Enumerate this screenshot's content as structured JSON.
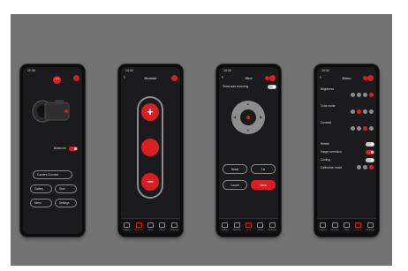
{
  "status": {
    "time": "10:34",
    "battery": "■■"
  },
  "phone1": {
    "badge_text": "LEICA",
    "toggle_label": "Bluetooth",
    "buttons": [
      "Camera Connect",
      "Gallery",
      "Shot",
      "Menu",
      "Settings"
    ]
  },
  "phone2": {
    "title": "Remote",
    "plus": "+",
    "minus": "−"
  },
  "phone3": {
    "title": "Shot",
    "toggle_label": "Show auto recording",
    "buttons": [
      "Reset",
      "Fix",
      "Cancel",
      "Save"
    ]
  },
  "phone4": {
    "title": "Menu",
    "rows": [
      "Brightness",
      "Color mode",
      "Contrast",
      "Reticle",
      "Image correction",
      "Cooling",
      "Calibration mode"
    ]
  },
  "tabs": [
    "Gallery",
    "Remote",
    "Shot",
    "Menu",
    "Settings"
  ],
  "colors": {
    "accent": "#d91e24",
    "frame": "#737373",
    "screen": "#1b1b1d"
  }
}
